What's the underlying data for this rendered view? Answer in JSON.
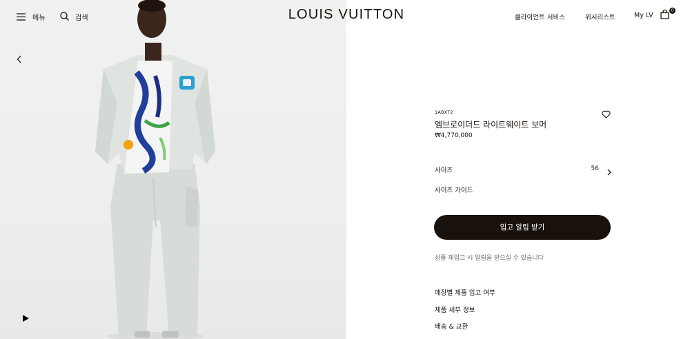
{
  "header": {
    "menu_label": "메뉴",
    "search_label": "검색",
    "logo": "LOUIS VUITTON",
    "client_service": "클라이언트 서비스",
    "wishlist": "위시리스트",
    "my_lv": "My LV",
    "bag_count": "0"
  },
  "product": {
    "sku": "1ABXT2",
    "name": "엠브로이더드 라이트웨이트 보머",
    "price": "₩4,770,000",
    "size_label": "사이즈",
    "size_value": "56",
    "size_guide": "사이즈 가이드",
    "notify_button": "입고 알림 받기",
    "restock_note": "상품 재입고 시 알림을 받으실 수 있습니다",
    "links": [
      "매장별 제품 입고 여부",
      "제품 세부 정보",
      "배송 & 교환"
    ]
  },
  "colors": {
    "primary": "#19110b",
    "muted": "#6b6b6b",
    "background": "#ffffff"
  },
  "icons": [
    "menu-icon",
    "search-icon",
    "shopping-bag-icon",
    "chevron-left-icon",
    "play-icon",
    "heart-icon",
    "chevron-right-icon"
  ]
}
